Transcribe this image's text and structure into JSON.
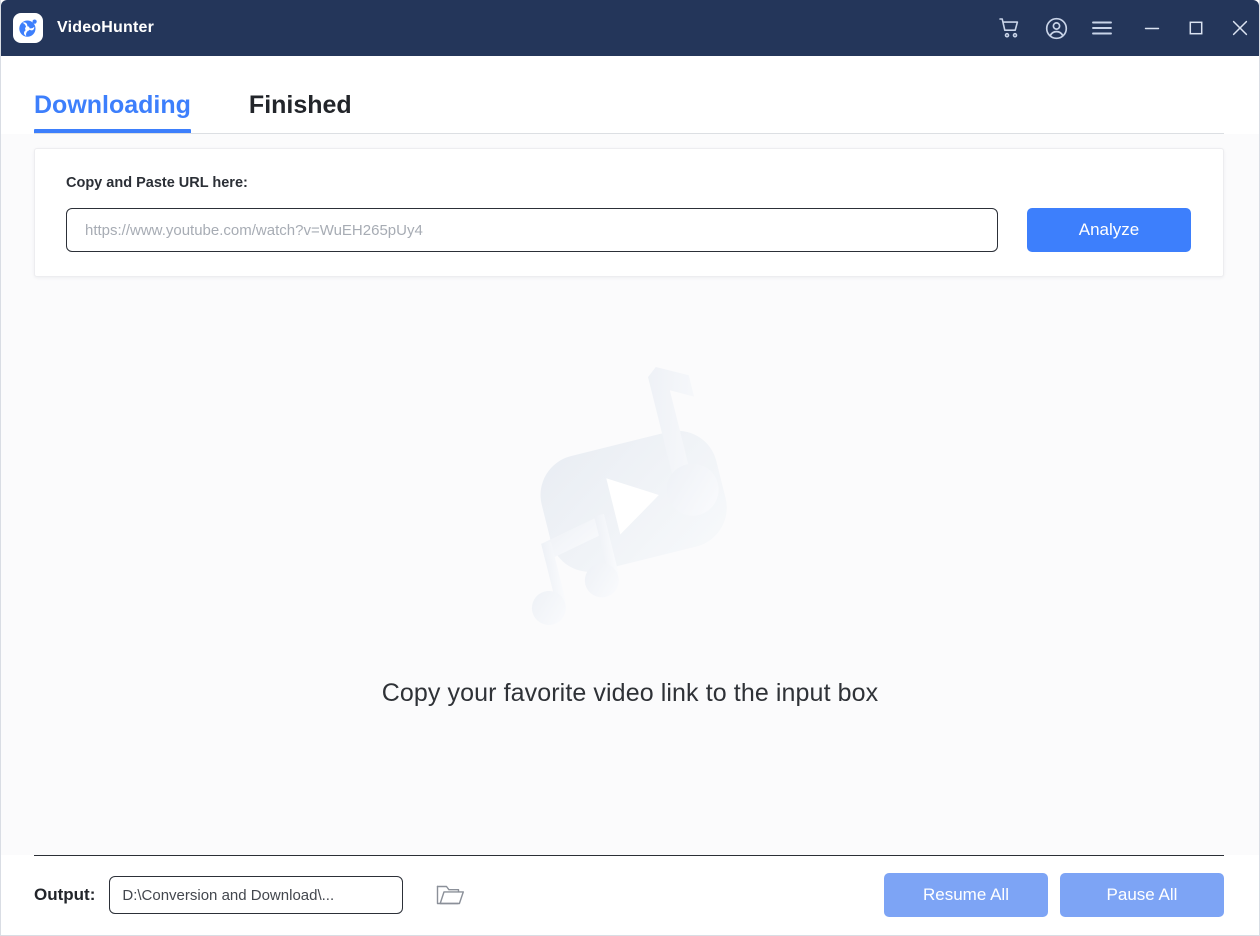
{
  "window": {
    "app_name": "VideoHunter",
    "logo_icon": "videohunter-app-icon",
    "titlebar_bg": "#24365a",
    "accent": "#3d7ffc",
    "disabled_accent": "#7da4f5",
    "controls": {
      "cart_icon": "shopping-cart-icon",
      "account_icon": "user-account-icon",
      "menu_icon": "hamburger-menu-icon",
      "minimize_icon": "minimize-icon",
      "maximize_icon": "maximize-icon",
      "close_icon": "close-icon"
    }
  },
  "tabs": [
    {
      "label": "Downloading",
      "active": true
    },
    {
      "label": "Finished",
      "active": false
    }
  ],
  "url_card": {
    "label": "Copy and Paste URL here:",
    "input_value": "",
    "input_placeholder": "https://www.youtube.com/watch?v=WuEH265pUy4",
    "analyze_label": "Analyze"
  },
  "empty_state": {
    "illustration_icon": "video-music-placeholder-illustration",
    "message": "Copy your favorite video link to the input box"
  },
  "footer": {
    "output_label": "Output:",
    "output_path": "D:\\Conversion and Download\\...",
    "folder_icon": "open-folder-icon",
    "resume_all_label": "Resume All",
    "pause_all_label": "Pause All"
  }
}
